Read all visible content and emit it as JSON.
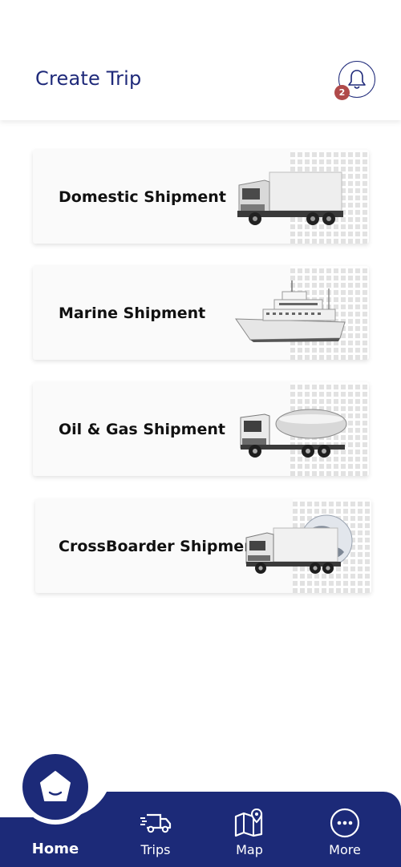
{
  "header": {
    "title": "Create Trip",
    "notification_count": "2",
    "bell_icon": "bell-icon"
  },
  "cards": [
    {
      "label": "Domestic Shipment",
      "icon": "box-truck-image"
    },
    {
      "label": "Marine Shipment",
      "icon": "ship-image"
    },
    {
      "label": "Oil & Gas Shipment",
      "icon": "tanker-truck-image"
    },
    {
      "label": "CrossBoarder Shipment",
      "icon": "globe-truck-image"
    }
  ],
  "nav": {
    "home": "Home",
    "trips": "Trips",
    "map": "Map",
    "more": "More"
  },
  "colors": {
    "primary": "#1c2a78",
    "title": "#1f2a7a",
    "badge": "#b04a4a"
  }
}
